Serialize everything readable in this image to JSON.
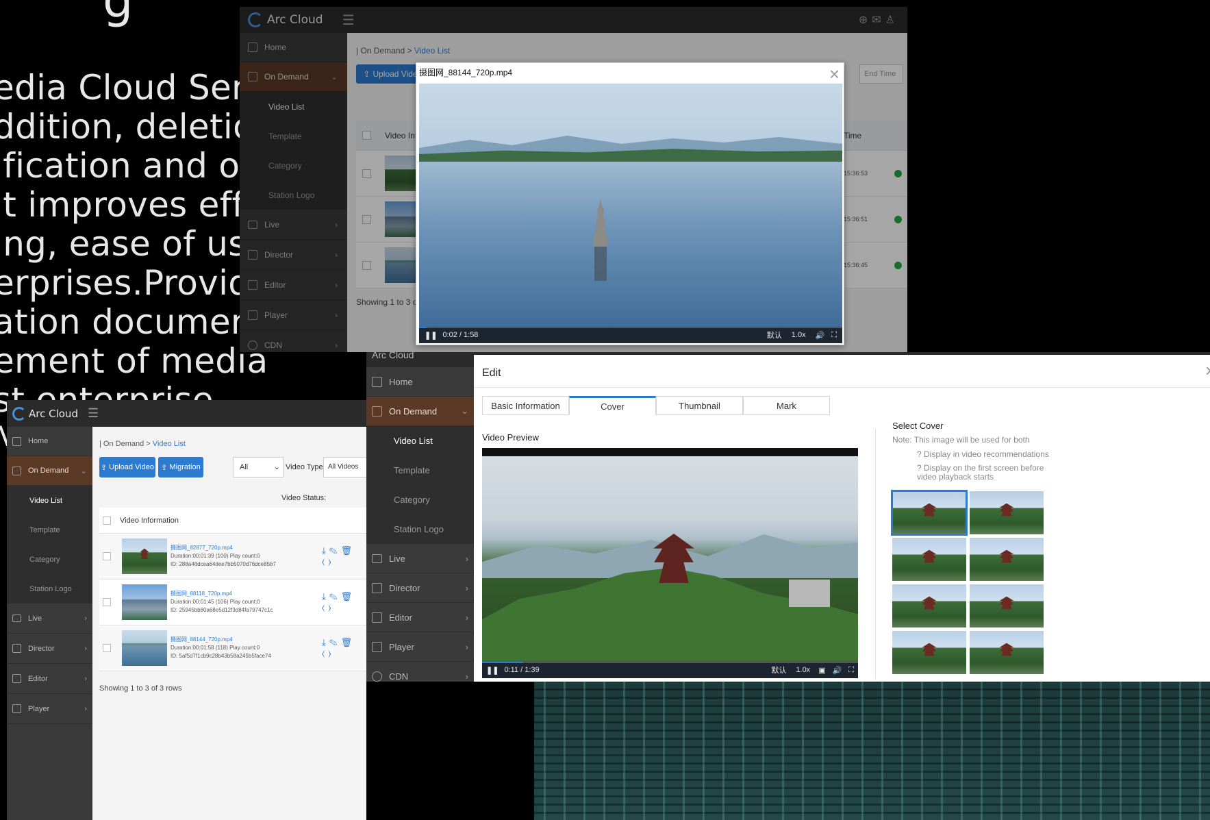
{
  "slide": {
    "partial_heading": "g",
    "text_lines": [
      "edia Cloud Service",
      "ddition, deletion,",
      "ification and other",
      "it improves efficiency,",
      "ing, ease of use, and",
      "erprises.Provide",
      "ation documentation",
      "ement of media",
      "st enterprise",
      "MS publishing systems"
    ]
  },
  "brand": "Arc Cloud",
  "nav": {
    "home": "Home",
    "on_demand": "On Demand",
    "video_list": "Video List",
    "template": "Template",
    "category": "Category",
    "station_logo": "Station Logo",
    "live": "Live",
    "director": "Director",
    "editor": "Editor",
    "player": "Player",
    "cdn": "CDN"
  },
  "win1": {
    "breadcrumb_parent": "| On Demand >",
    "breadcrumb_current": "Video List",
    "upload_button": "Upload Vide",
    "end_time": "End Time",
    "col_info": "Video Info",
    "col_time": "Time",
    "rows": [
      {
        "time": "15:36:53"
      },
      {
        "time": "15:36:51"
      },
      {
        "time": "15:36:45"
      }
    ],
    "showing": "Showing 1 to 3 o",
    "player_modal": {
      "title": "摄图网_88144_720p.mp4",
      "time": "0:02 / 1:58",
      "quality": "默认",
      "speed": "1.0x",
      "progress": 0.017
    }
  },
  "win2": {
    "breadcrumb_parent": "| On Demand >",
    "breadcrumb_current": "Video List",
    "upload_button": "Upload Video",
    "migration_button": "Migration",
    "filter_all": "All",
    "video_type_label": "Video Type:",
    "video_type_value": "All Videos",
    "video_status_label": "Video Status:",
    "col_info": "Video Information",
    "rows": [
      {
        "name": "摄图网_82877_720p.mp4",
        "duration": "Duration:00:01:39 (100)  Play count:0",
        "id": "ID: 288a48dcea64dee7bb5070d76dce85b7"
      },
      {
        "name": "摄图网_88118_720p.mp4",
        "duration": "Duration:00:01:45 (106)  Play count:0",
        "id": "ID: 25945bb80a68e5d12f3d84fa79747c1c"
      },
      {
        "name": "摄图网_88144_720p.mp4",
        "duration": "Duration:00:01:58 (118)  Play count:0",
        "id": "ID: 5af5d7f1cb9c28b43b58a245b5face74"
      }
    ],
    "showing": "Showing 1 to 3 of 3 rows"
  },
  "win3": {
    "partial_brand": "Arc Cloud",
    "edit_modal": {
      "title": "Edit",
      "tabs": [
        "Basic Information",
        "Cover",
        "Thumbnail",
        "Mark"
      ],
      "active_tab": 1,
      "video_preview_label": "Video Preview",
      "time": "0:11 / 1:39",
      "quality": "默认",
      "speed": "1.0x",
      "progress": 0.11,
      "select_cover_title": "Select Cover",
      "note": "Note: This image will be used for both",
      "note_item1": "? Display in video recommendations",
      "note_item2": "? Display on the first screen before video playback starts"
    }
  },
  "colors": {
    "accent_blue": "#2d7ad1",
    "active_nav": "#5a3a26",
    "status_green": "#27a844"
  }
}
